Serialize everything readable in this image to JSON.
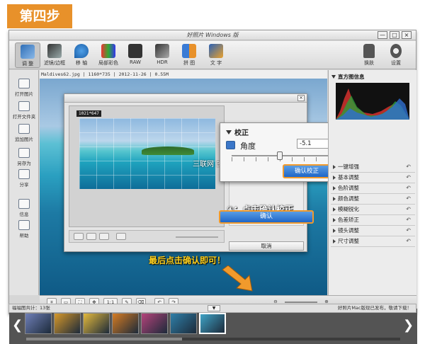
{
  "step_badge": "第四步",
  "window": {
    "title": "好照片 Windows 版",
    "controls": [
      "—",
      "□",
      "×"
    ]
  },
  "toolbar": {
    "items": [
      {
        "label": "调 整",
        "icon": "pencil-adjust-icon"
      },
      {
        "label": "滤镜/边框",
        "icon": "filter-frame-icon"
      },
      {
        "label": "移 轴",
        "icon": "tilt-shift-icon"
      },
      {
        "label": "局部彩色",
        "icon": "partial-color-icon"
      },
      {
        "label": "RAW",
        "icon": "raw-camera-icon"
      },
      {
        "label": "HDR",
        "icon": "hdr-icon"
      },
      {
        "label": "拼 图",
        "icon": "collage-icon"
      },
      {
        "label": "文 字",
        "icon": "text-icon"
      }
    ],
    "right_items": [
      {
        "label": "换肤",
        "icon": "shirt-skin-icon"
      },
      {
        "label": "设置",
        "icon": "gear-settings-icon"
      }
    ]
  },
  "sidebar": {
    "items": [
      {
        "label": "打开图片",
        "icon": "open-image-icon"
      },
      {
        "label": "打开文件夹",
        "icon": "open-folder-icon"
      },
      {
        "label": "追加图片",
        "icon": "add-image-icon"
      },
      {
        "label": "另存为",
        "icon": "save-as-icon"
      },
      {
        "label": "分享",
        "icon": "share-icon"
      },
      {
        "label": "信息",
        "icon": "info-icon"
      },
      {
        "label": "帮助",
        "icon": "help-icon"
      }
    ]
  },
  "photo_info": "Maldives62.jpg | 1160*735 | 2012-11-26 | 0.55M",
  "watermark": "三联网 3LIAN.COM",
  "dialog": {
    "size_label": "1021*647",
    "confirm_label": "确认",
    "cancel_label": "取消"
  },
  "correction": {
    "title": "校正",
    "angle_label": "角度",
    "angle_value": "-5.1",
    "apply_button": "确认校正"
  },
  "annotations": {
    "step4": "④：点击确认校正",
    "final": "最后点击确认即可！"
  },
  "right_panel": {
    "histogram_title": "直方图信息",
    "items": [
      "一键增强",
      "基本调整",
      "色阶调整",
      "颜色调整",
      "模糊锐化",
      "色差矫正",
      "镜头调整",
      "尺寸调整"
    ],
    "undo_icon": "↶"
  },
  "bottom_toolbar": {
    "ratio_label": "1:1"
  },
  "filmstrip": {
    "thumbs": [
      {
        "color": "#6f7fb7"
      },
      {
        "color": "#d6982a"
      },
      {
        "color": "#e3b93c"
      },
      {
        "color": "#d57b22"
      },
      {
        "color": "#b4437a"
      },
      {
        "color": "#2f7fa8"
      },
      {
        "color": "#3fa3c6"
      }
    ],
    "left_arrow": "❮",
    "right_arrow": "❯"
  },
  "status": {
    "count": "福福图共计：13张",
    "promo": "好照片Mac版现已发布，敬请下载！"
  }
}
